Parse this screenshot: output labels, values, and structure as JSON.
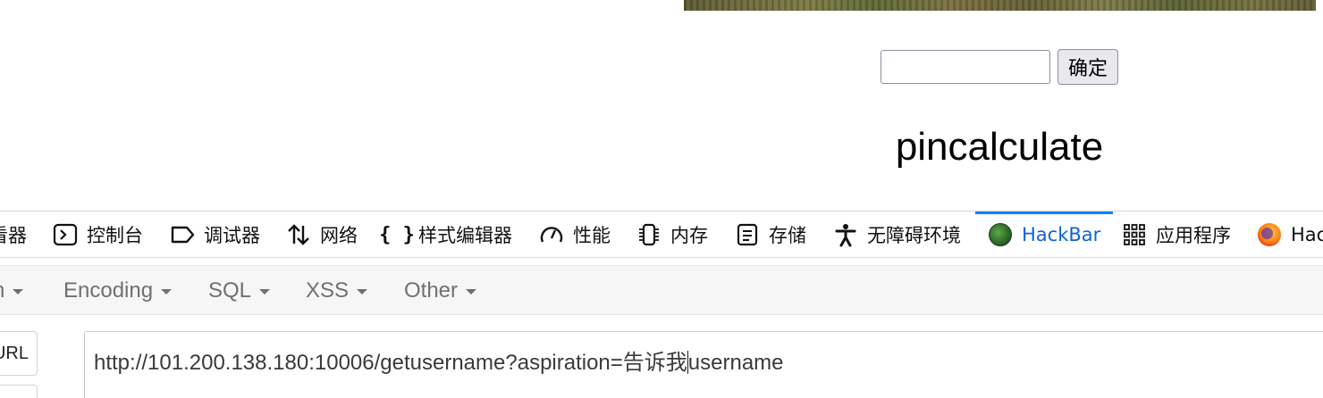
{
  "page": {
    "confirm_label": "确定",
    "input_value": "",
    "heading": "pincalculate"
  },
  "devtools": {
    "tabs": [
      {
        "label": "查看器",
        "shown": "看器",
        "icon": "inspector-icon"
      },
      {
        "label": "控制台",
        "icon": "console-icon"
      },
      {
        "label": "调试器",
        "icon": "debugger-icon"
      },
      {
        "label": "网络",
        "icon": "network-icon"
      },
      {
        "label": "样式编辑器",
        "icon": "style-editor-icon"
      },
      {
        "label": "性能",
        "icon": "performance-icon"
      },
      {
        "label": "内存",
        "icon": "memory-icon"
      },
      {
        "label": "存储",
        "icon": "storage-icon"
      },
      {
        "label": "无障碍环境",
        "icon": "accessibility-icon"
      },
      {
        "label": "HackBar",
        "icon": "hackbar-icon",
        "active": true
      },
      {
        "label": "应用程序",
        "icon": "application-icon"
      },
      {
        "label": "Hac",
        "icon": "firefox-icon"
      }
    ],
    "active_color": "#0a84ff"
  },
  "hackbar": {
    "menu": [
      {
        "label": "n"
      },
      {
        "label": "Encoding"
      },
      {
        "label": "SQL"
      },
      {
        "label": "XSS"
      },
      {
        "label": "Other"
      }
    ],
    "url_button_label": "URL",
    "url_before_caret": "http://101.200.138.180:10006/getusername?aspiration=告诉我",
    "url_after_caret": "username"
  }
}
